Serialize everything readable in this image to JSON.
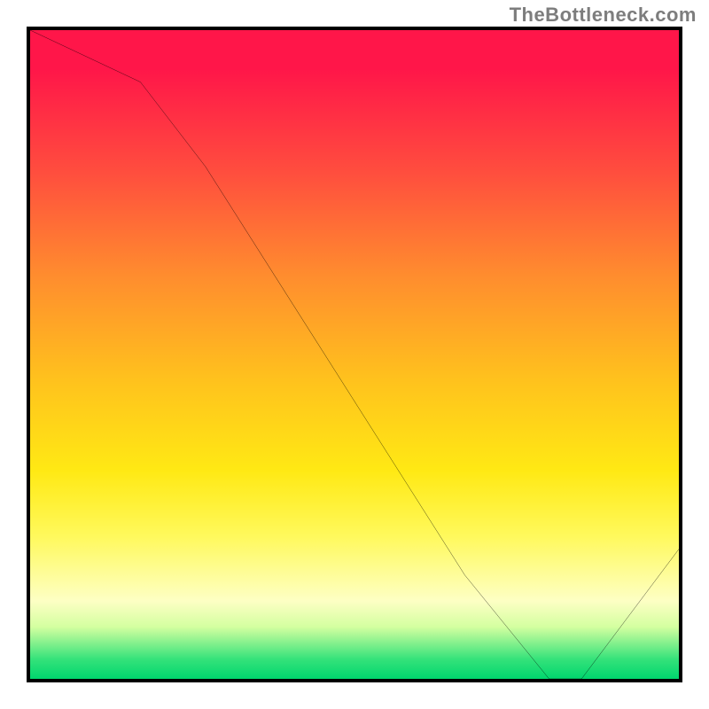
{
  "attribution": "TheBottleneck.com",
  "chart_data": {
    "type": "line",
    "title": "",
    "xlabel": "",
    "ylabel": "",
    "xlim": [
      0,
      100
    ],
    "ylim": [
      0,
      100
    ],
    "x": [
      0,
      17,
      27,
      67,
      80,
      85,
      100
    ],
    "values": [
      100,
      92,
      79,
      16,
      0,
      0,
      20
    ],
    "background": "gradient_red_to_green_vertical",
    "x_axis_marker": {
      "position": 82,
      "label": ""
    }
  },
  "colors": {
    "border": "#000000",
    "line": "#000000",
    "attribution_text": "#7d7d7d",
    "marker_text": "#ff3b2f",
    "gradient_stops": [
      "#ff1649",
      "#ff8d2e",
      "#ffe914",
      "#fdffc4",
      "#00d66e"
    ]
  }
}
